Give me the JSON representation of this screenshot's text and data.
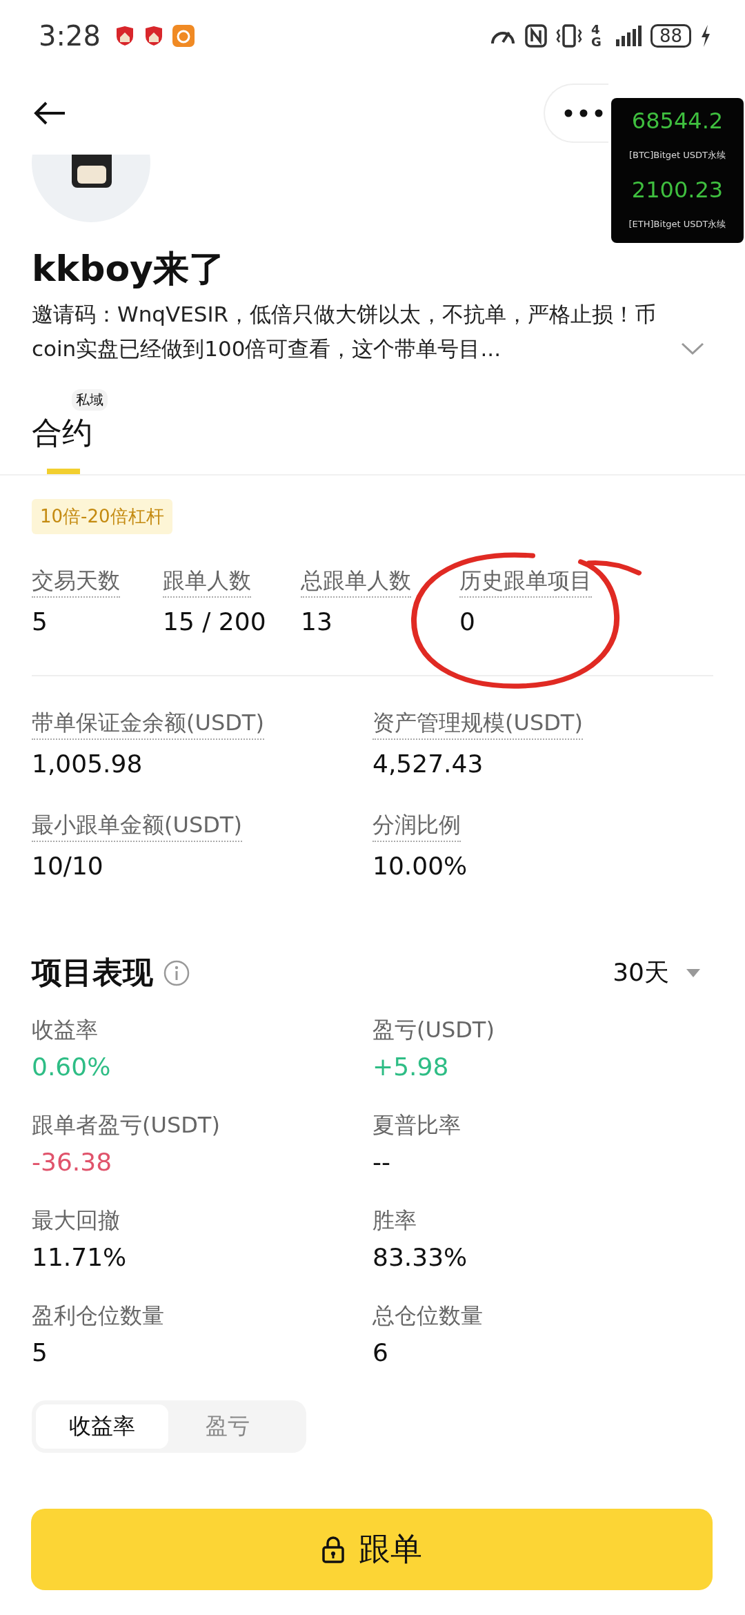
{
  "status_bar": {
    "time": "3:28",
    "network": "4G",
    "battery": "88"
  },
  "ticker": [
    {
      "price": "68544.2",
      "label": "[BTC]Bitget USDT永续"
    },
    {
      "price": "2100.23",
      "label": "[ETH]Bitget USDT永续"
    }
  ],
  "profile": {
    "name": "kkboy来了",
    "bio": "邀请码：WnqVESIR，低倍只做大饼以太，不抗单，严格止损！币coin实盘已经做到100倍可查看，这个带单号目..."
  },
  "tabs": [
    {
      "label": "合约",
      "badge": "私域",
      "selected": true
    }
  ],
  "tag": "10倍-20倍杠杆",
  "stats": [
    {
      "label": "交易天数",
      "value": "5"
    },
    {
      "label": "跟单人数",
      "value": "15 / 200"
    },
    {
      "label": "总跟单人数",
      "value": "13"
    },
    {
      "label": "历史跟单项目",
      "value": "0"
    }
  ],
  "info": [
    {
      "label": "带单保证金余额(USDT)",
      "value": "1,005.98"
    },
    {
      "label": "资产管理规模(USDT)",
      "value": "4,527.43"
    },
    {
      "label": "最小跟单金额(USDT)",
      "value": "10/10"
    },
    {
      "label": "分润比例",
      "value": "10.00%"
    }
  ],
  "performance": {
    "title": "项目表现",
    "period": "30天",
    "metrics": [
      {
        "label": "收益率",
        "value": "0.60%",
        "color": "#2ebd85"
      },
      {
        "label": "盈亏(USDT)",
        "value": "+5.98",
        "color": "#2ebd85"
      },
      {
        "label": "跟单者盈亏(USDT)",
        "value": "-36.38",
        "color": "#e0536b"
      },
      {
        "label": "夏普比率",
        "value": "--",
        "color": "#111111"
      },
      {
        "label": "最大回撤",
        "value": "11.71%",
        "color": "#111111"
      },
      {
        "label": "胜率",
        "value": "83.33%",
        "color": "#111111"
      },
      {
        "label": "盈利仓位数量",
        "value": "5",
        "color": "#111111"
      },
      {
        "label": "总仓位数量",
        "value": "6",
        "color": "#111111"
      }
    ]
  },
  "chart_tabs": [
    {
      "label": "收益率",
      "selected": true
    },
    {
      "label": "盈亏",
      "selected": false
    }
  ],
  "follow_button": "跟单"
}
